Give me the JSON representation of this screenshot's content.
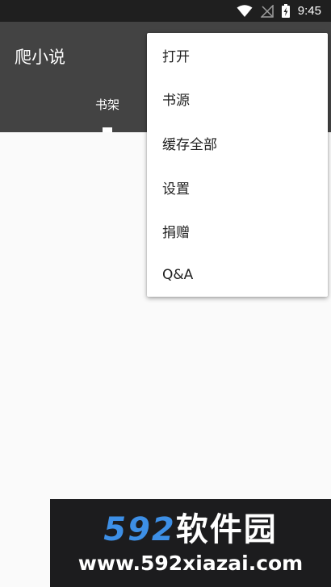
{
  "status_bar": {
    "time": "9:45",
    "icons": [
      "wifi-icon",
      "signal-off-icon",
      "battery-charging-icon"
    ]
  },
  "app_bar": {
    "title": "爬小说",
    "tabs": [
      {
        "label": "书架",
        "selected": true
      }
    ]
  },
  "overflow_menu": {
    "items": [
      {
        "label": "打开"
      },
      {
        "label": "书源"
      },
      {
        "label": "缓存全部"
      },
      {
        "label": "设置"
      },
      {
        "label": "捐赠"
      },
      {
        "label": "Q&A"
      }
    ]
  },
  "watermark": {
    "numbers": "592",
    "brand": "软件园",
    "url": "www.592xiazai.com"
  },
  "colors": {
    "status_bar_bg": "#1f1f1f",
    "app_bar_bg": "#434343",
    "content_bg": "#fafafa",
    "menu_bg": "#ffffff",
    "watermark_accent": "#3d8fe6"
  }
}
